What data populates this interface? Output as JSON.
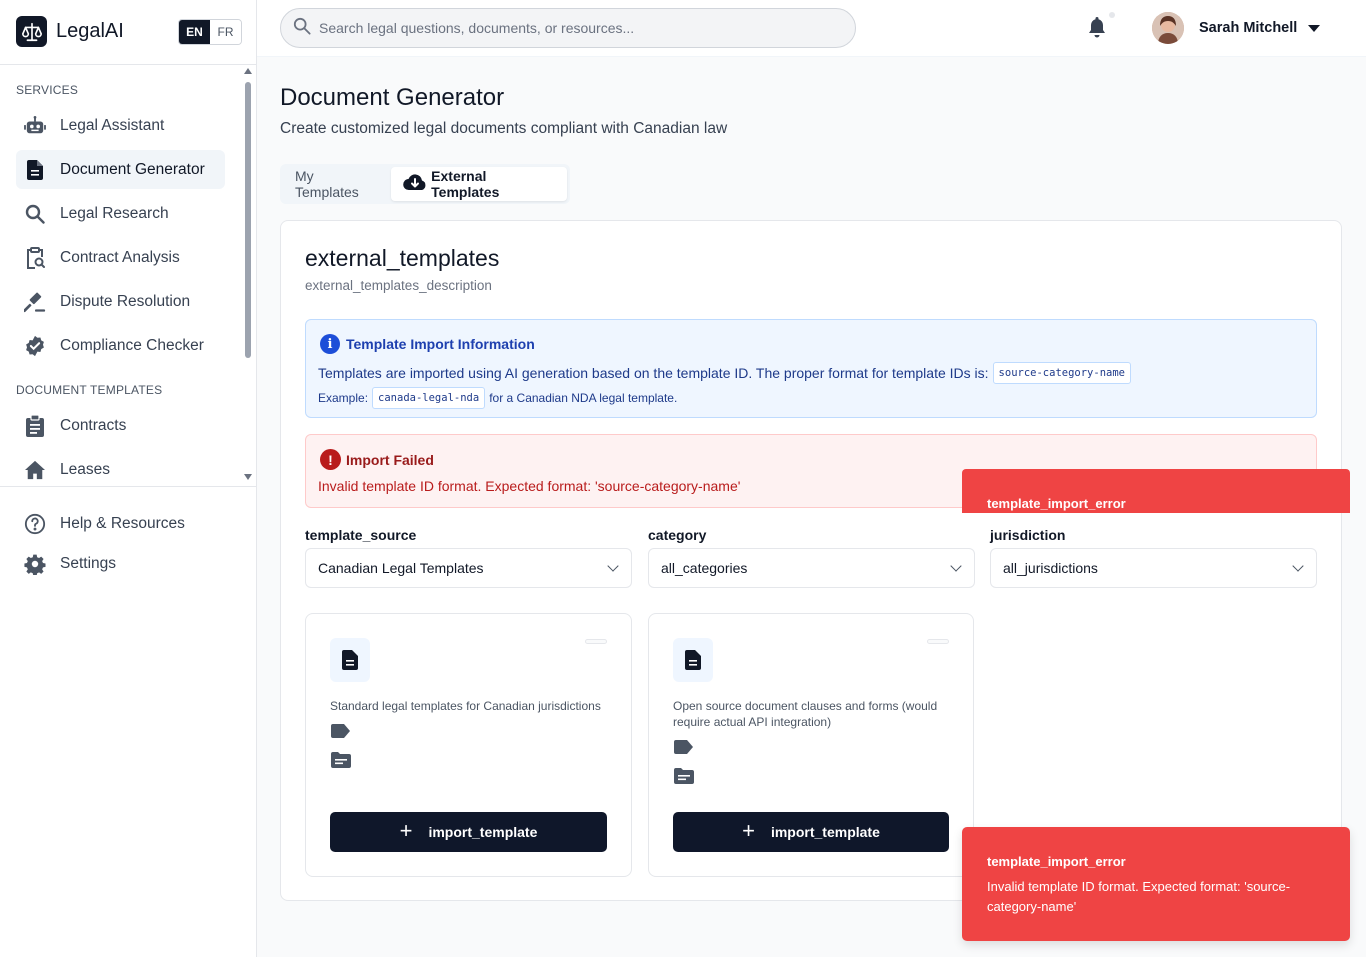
{
  "brand": {
    "name": "LegalAI"
  },
  "language": {
    "options": [
      "EN",
      "FR"
    ],
    "selected": "EN"
  },
  "sidebar": {
    "services_label": "SERVICES",
    "services": [
      {
        "label": "Legal Assistant",
        "icon": "robot-icon"
      },
      {
        "label": "Document Generator",
        "icon": "document-icon",
        "active": true
      },
      {
        "label": "Legal Research",
        "icon": "search-icon"
      },
      {
        "label": "Contract Analysis",
        "icon": "clipboard-search-icon"
      },
      {
        "label": "Dispute Resolution",
        "icon": "gavel-icon"
      },
      {
        "label": "Compliance Checker",
        "icon": "badge-check-icon"
      }
    ],
    "templates_label": "DOCUMENT TEMPLATES",
    "templates": [
      {
        "label": "Contracts",
        "icon": "clipboard-list-icon"
      },
      {
        "label": "Leases",
        "icon": "home-icon"
      }
    ],
    "bottom": [
      {
        "label": "Help & Resources",
        "icon": "help-circle-icon"
      },
      {
        "label": "Settings",
        "icon": "gear-icon"
      }
    ]
  },
  "header": {
    "search_placeholder": "Search legal questions, documents, or resources...",
    "user_name": "Sarah Mitchell"
  },
  "page": {
    "title": "Document Generator",
    "subtitle": "Create customized legal documents compliant with Canadian law",
    "tabs": [
      {
        "label": "My Templates",
        "active": false
      },
      {
        "label": "External Templates",
        "active": true,
        "icon": "cloud-download-icon"
      }
    ]
  },
  "external": {
    "title": "external_templates",
    "description": "external_templates_description",
    "info": {
      "title": "Template Import Information",
      "text": "Templates are imported using AI generation based on the template ID. The proper format for template IDs is:",
      "format_code": "source-category-name",
      "example_prefix": "Example:",
      "example_code": "canada-legal-nda",
      "example_suffix": "for a Canadian NDA legal template."
    },
    "error": {
      "title": "Import Failed",
      "message": "Invalid template ID format. Expected format: 'source-category-name'"
    },
    "filters": [
      {
        "label": "template_source",
        "value": "Canadian Legal Templates"
      },
      {
        "label": "category",
        "value": "all_categories"
      },
      {
        "label": "jurisdiction",
        "value": "all_jurisdictions"
      }
    ],
    "templates": [
      {
        "description": "Standard legal templates for Canadian jurisdictions",
        "button": "import_template"
      },
      {
        "description": "Open source document clauses and forms (would require actual API integration)",
        "button": "import_template"
      }
    ]
  },
  "toasts": [
    {
      "title": "template_import_error"
    },
    {
      "title": "template_import_error",
      "message": "Invalid template ID format. Expected format: 'source-category-name'"
    }
  ],
  "colors": {
    "primary": "#0f172a",
    "info_bg": "#eff6ff",
    "error_bg": "#fef2f2",
    "toast_red": "#ef4444"
  }
}
